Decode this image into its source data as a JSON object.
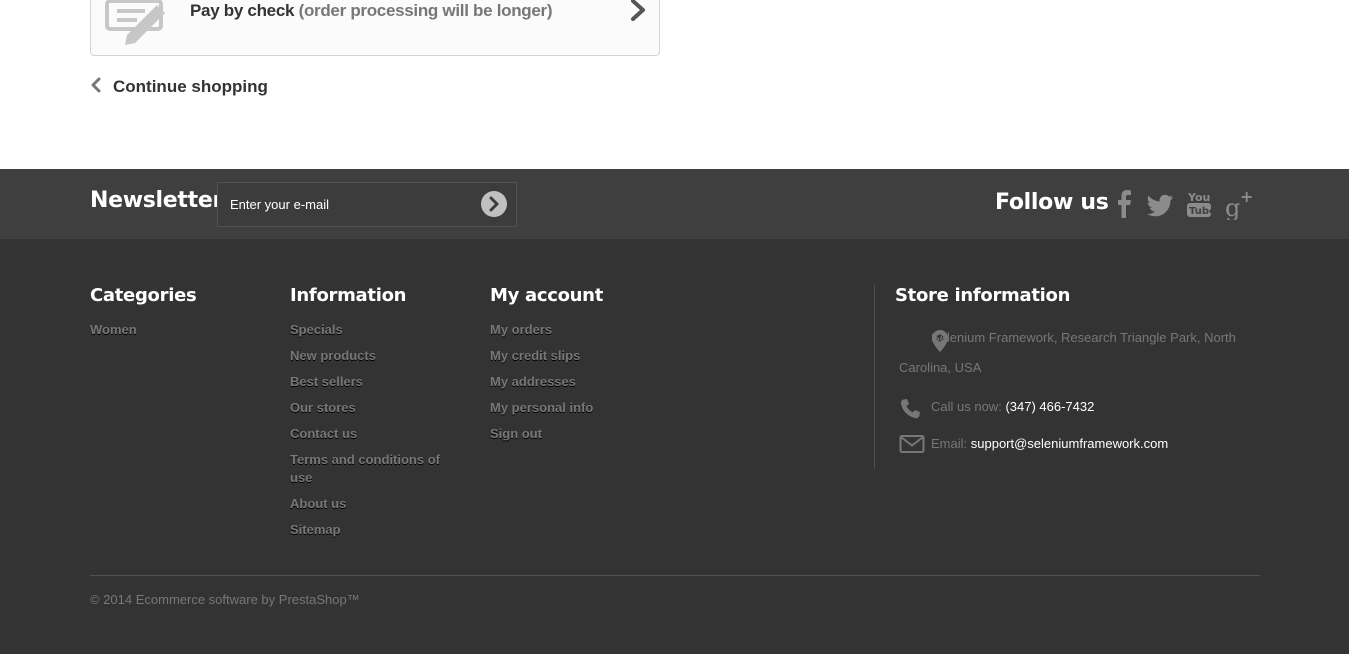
{
  "payment": {
    "label": "Pay by check",
    "sub_label": "(order processing will be longer)"
  },
  "continue_shopping": "Continue shopping",
  "newsletter": {
    "title": "Newsletter",
    "placeholder": "Enter your e-mail"
  },
  "follow": {
    "title": "Follow us",
    "icons": [
      "facebook-icon",
      "twitter-icon",
      "youtube-icon",
      "google-plus-icon"
    ]
  },
  "categories": {
    "title": "Categories",
    "items": [
      "Women"
    ]
  },
  "information": {
    "title": "Information",
    "items": [
      "Specials",
      "New products",
      "Best sellers",
      "Our stores",
      "Contact us",
      "Terms and conditions of use",
      "About us",
      "Sitemap"
    ]
  },
  "my_account": {
    "title": "My account",
    "items": [
      "My orders",
      "My credit slips",
      "My addresses",
      "My personal info",
      "Sign out"
    ]
  },
  "store_information": {
    "title": "Store information",
    "address": "Selenium Framework, Research Triangle Park, North Carolina, USA",
    "phone_label": "Call us now:",
    "phone": "(347) 466-7432",
    "email_label": "Email:",
    "email": "support@seleniumframework.com"
  },
  "copyright": "© 2014 Ecommerce software by PrestaShop™",
  "colors": {
    "band": "#3f3f3f",
    "footer": "#333333",
    "muted_text": "#777777",
    "white_text": "#ffffff"
  }
}
